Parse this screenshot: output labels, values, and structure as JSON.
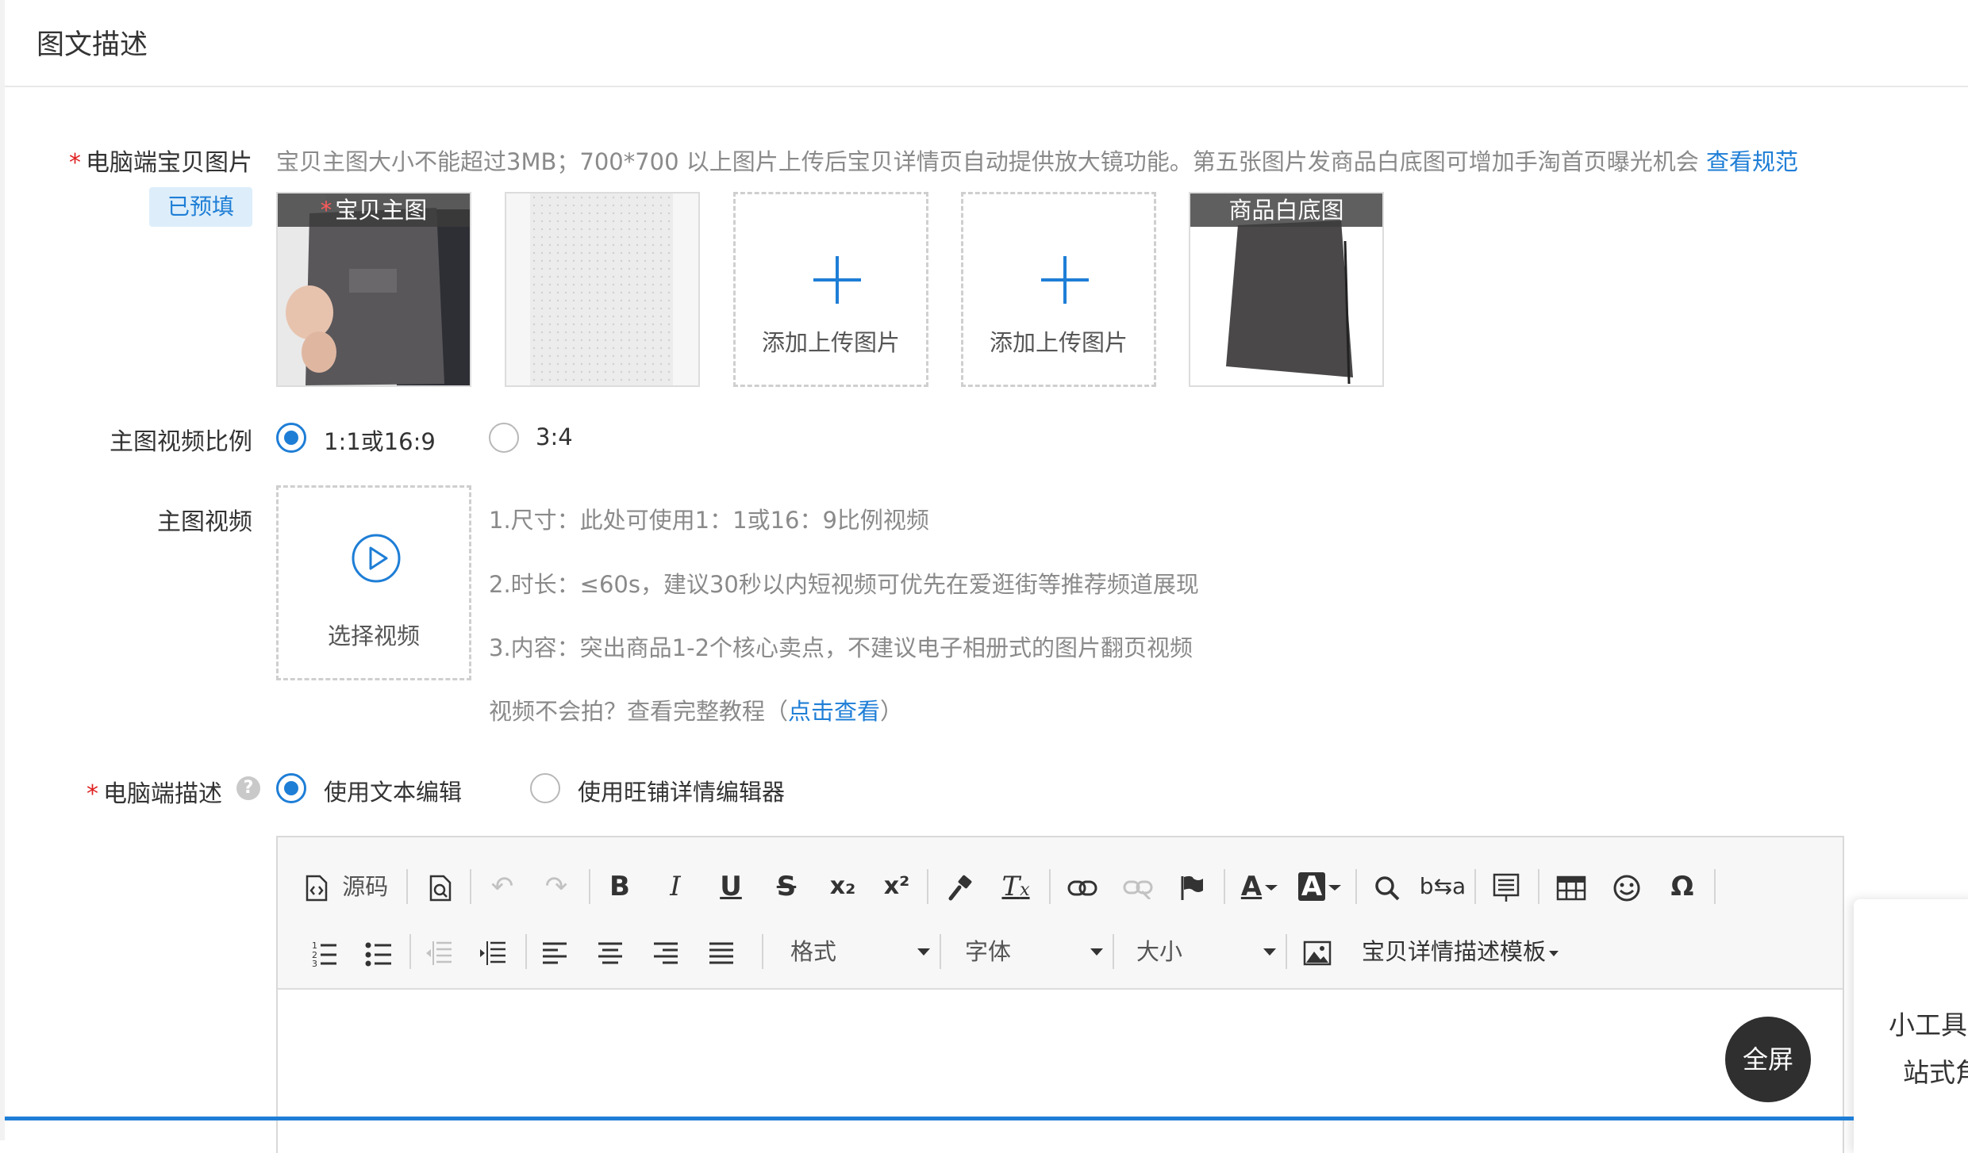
{
  "section": {
    "title": "图文描述"
  },
  "pc_images": {
    "required_mark": "*",
    "label": "电脑端宝贝图片",
    "hint": "宝贝主图大小不能超过3MB；700*700 以上图片上传后宝贝详情页自动提供放大镜功能。第五张图片发商品白底图可增加手淘首页曝光机会",
    "hint_link": "查看规范",
    "prefilled_tag": "已预填",
    "slots": [
      {
        "banner": "宝贝主图",
        "required_mark": "*"
      },
      {
        "banner": ""
      },
      {
        "text": "添加上传图片"
      },
      {
        "text": "添加上传图片"
      },
      {
        "banner": "商品白底图"
      }
    ]
  },
  "video_ratio": {
    "label": "主图视频比例",
    "options": [
      {
        "label": "1:1或16:9",
        "checked": true
      },
      {
        "label": "3:4",
        "checked": false
      }
    ]
  },
  "main_video": {
    "label": "主图视频",
    "select_label": "选择视频",
    "tips": [
      "1.尺寸：此处可使用1：1或16：9比例视频",
      "2.时长：≤60s，建议30秒以内短视频可优先在爱逛街等推荐频道展现",
      "3.内容：突出商品1-2个核心卖点，不建议电子相册式的图片翻页视频"
    ],
    "tutorial_prefix": "视频不会拍？查看完整教程（",
    "tutorial_link": "点击查看",
    "tutorial_suffix": "）"
  },
  "pc_desc": {
    "required_mark": "*",
    "label": "电脑端描述",
    "help_icon": "?",
    "options": [
      {
        "label": "使用文本编辑",
        "checked": true
      },
      {
        "label": "使用旺铺详情编辑器",
        "checked": false
      }
    ]
  },
  "editor": {
    "source_label": "源码",
    "format_label": "格式",
    "font_label": "字体",
    "size_label": "大小",
    "template_label": "宝贝详情描述模板"
  },
  "fullscreen_label": "全屏",
  "side_panel": {
    "line1": "小工具",
    "line2": "站式角"
  },
  "colors": {
    "accent": "#1e7ed6",
    "required": "#e02020",
    "hint": "#8a8a8a"
  }
}
